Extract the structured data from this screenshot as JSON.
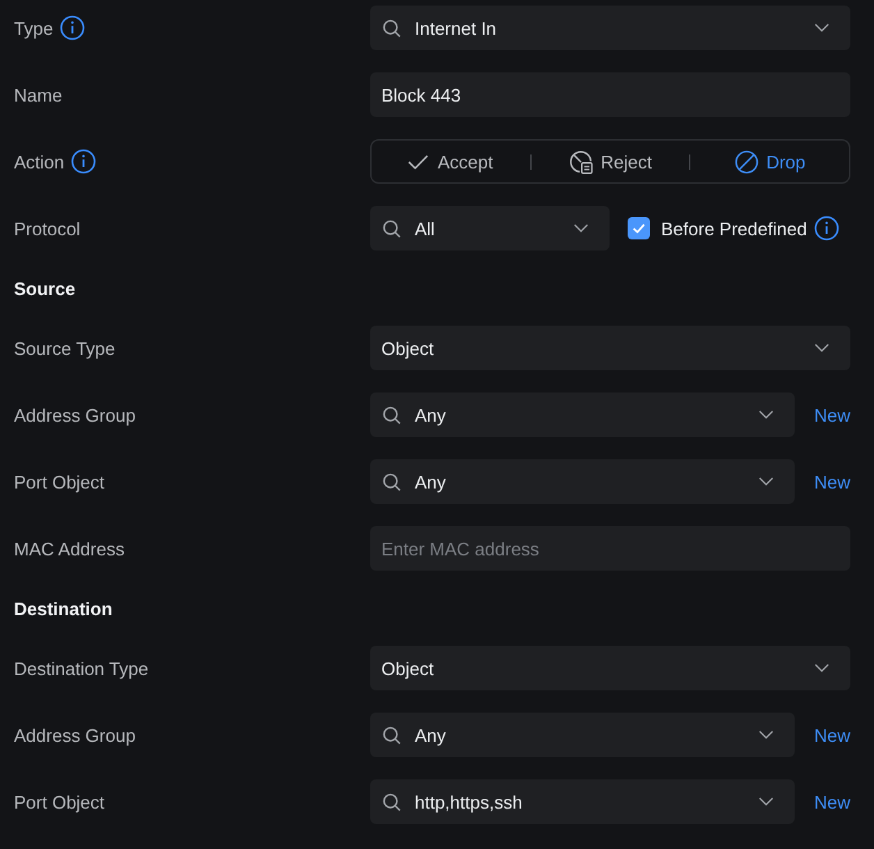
{
  "rows": [
    {
      "kind": "select",
      "label": "Type",
      "info": true,
      "searchable": true,
      "value": "Internet In"
    },
    {
      "kind": "text",
      "label": "Name",
      "value": "Block 443"
    },
    {
      "kind": "segmented",
      "label": "Action",
      "info": true,
      "options": [
        {
          "label": "Accept",
          "selected": false
        },
        {
          "label": "Reject",
          "selected": false
        },
        {
          "label": "Drop",
          "selected": true
        }
      ]
    },
    {
      "kind": "select",
      "label": "Protocol",
      "searchable": true,
      "value": "All",
      "checkbox": {
        "label": "Before Predefined",
        "checked": true,
        "info": true
      }
    },
    {
      "kind": "section",
      "label": "Source"
    },
    {
      "kind": "select",
      "label": "Source Type",
      "searchable": false,
      "value": "Object"
    },
    {
      "kind": "select",
      "label": "Address Group",
      "searchable": true,
      "value": "Any",
      "link": "New"
    },
    {
      "kind": "select",
      "label": "Port Object",
      "searchable": true,
      "value": "Any",
      "link": "New"
    },
    {
      "kind": "text",
      "label": "MAC Address",
      "placeholder": "Enter MAC address"
    },
    {
      "kind": "section",
      "label": "Destination"
    },
    {
      "kind": "select",
      "label": "Destination Type",
      "searchable": false,
      "value": "Object"
    },
    {
      "kind": "select",
      "label": "Address Group",
      "searchable": true,
      "value": "Any",
      "link": "New"
    },
    {
      "kind": "select",
      "label": "Port Object",
      "searchable": true,
      "value": "http,https,ssh",
      "link": "New"
    }
  ]
}
